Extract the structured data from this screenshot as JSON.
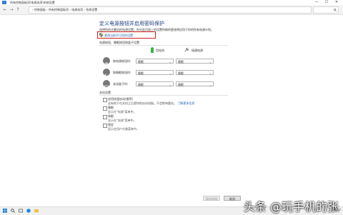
{
  "window": {
    "title": "所有控制面板项\\电源选项\\系统设置",
    "minimize": "—",
    "maximize": "☐",
    "close": "✕"
  },
  "address": {
    "path": "› 控制面板 › 所有控制面板项 › 电源选项 › 系统设置"
  },
  "page": {
    "heading": "定义电源按钮并启用密码保护",
    "description": "选择你的计算机的电源设置。你对此页面上的设置所做的更改将应用于你的所有电源计划。",
    "change_link": "更改当前不可用的设置"
  },
  "power_section": {
    "label": "电源按钮、睡眠按钮和盖子设置"
  },
  "columns": [
    {
      "label": "用电池",
      "icon": "battery-icon"
    },
    {
      "label": "接通电源",
      "icon": "plug-icon"
    }
  ],
  "rows": [
    {
      "label": "按电源按钮时:",
      "icon": "power-icon",
      "battery": "睡眠",
      "plugged": "睡眠"
    },
    {
      "label": "按睡眠按钮时:",
      "icon": "moon-icon",
      "battery": "睡眠",
      "plugged": "睡眠"
    },
    {
      "label": "关闭盖子时:",
      "icon": "lid-icon",
      "battery": "睡眠",
      "plugged": "睡眠"
    }
  ],
  "shutdown_section": {
    "label": "关机设置",
    "options": [
      {
        "title": "启用快速启动(推荐)",
        "desc": "这有助于在关机之后更快地启动电脑。不会影响重启。",
        "link": "了解更多信息"
      },
      {
        "title": "睡眠",
        "desc": "显示在\"电源\"菜单中。"
      },
      {
        "title": "休眠",
        "desc": "显示在\"电源\"菜单中。"
      },
      {
        "title": "锁定",
        "desc": "显示在用户头像菜单中。"
      }
    ]
  },
  "buttons": {
    "save": "保存修改",
    "cancel": "取消"
  },
  "watermark": "头条 @玩手机的张",
  "clock": {
    "date": "2021/"
  }
}
